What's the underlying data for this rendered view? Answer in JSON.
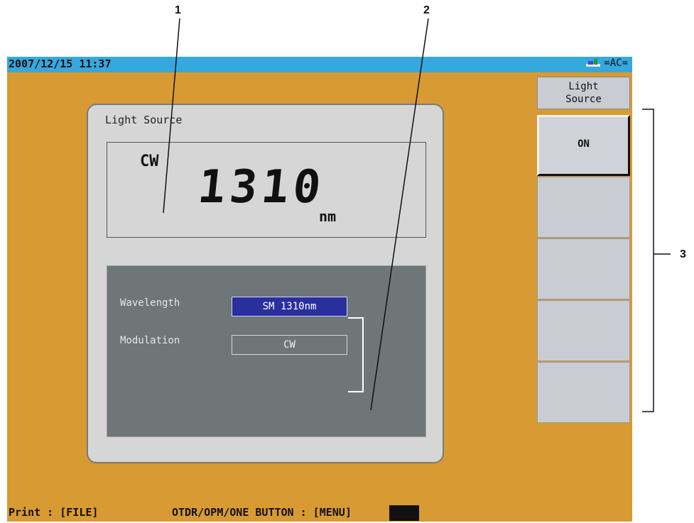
{
  "callouts": [
    "1",
    "2",
    "3"
  ],
  "status_bar": {
    "datetime": "2007/12/15 11:37",
    "power_label": "=AC="
  },
  "panel": {
    "title": "Light Source",
    "mode": "CW",
    "wavelength_display": "1310",
    "unit": "nm",
    "settings": [
      {
        "label": "Wavelength",
        "value": "SM 1310nm",
        "selected": true
      },
      {
        "label": "Modulation",
        "value": "CW",
        "selected": false
      }
    ]
  },
  "softkeys": {
    "title_line1": "Light",
    "title_line2": "Source",
    "buttons": [
      "ON",
      "",
      "",
      "",
      ""
    ]
  },
  "bottom_bar": {
    "print_hint": "Print : [FILE]",
    "menu_hint": "OTDR/OPM/ONE BUTTON : [MENU]"
  },
  "colors": {
    "screen_bg": "#d89a33",
    "top_bar": "#35a8dd",
    "panel": "#d6d6d6",
    "settings_bg": "#6f7677",
    "selected_field": "#2a2f9e"
  }
}
